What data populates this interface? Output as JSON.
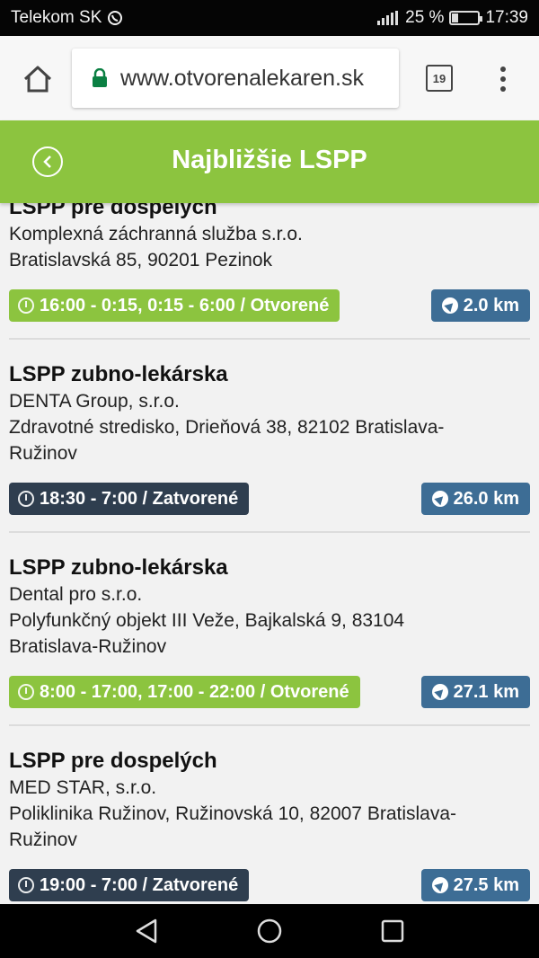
{
  "status_bar": {
    "carrier": "Telekom SK",
    "battery_percent": "25 %",
    "battery_level": 0.25,
    "time": "17:39",
    "signal_icon": "signal-icon",
    "whatsapp_icon": "whatsapp-icon"
  },
  "browser": {
    "url": "www.otvorenalekaren.sk",
    "tab_count": "19"
  },
  "header": {
    "title": "Najbližšie LSPP"
  },
  "colors": {
    "header_green": "#8cc43f",
    "open_badge": "#8cc43f",
    "closed_badge": "#2f3e4f",
    "distance_badge": "#3d6d95"
  },
  "entries": [
    {
      "title": "LSPP pre dospelých",
      "provider": "Komplexná záchranná služba s.r.o.",
      "address_lines": [
        "Bratislavská 85, 90201 Pezinok"
      ],
      "hours": "16:00 - 0:15, 0:15 - 6:00 / Otvorené",
      "status": "open",
      "distance": "2.0 km"
    },
    {
      "title": "LSPP zubno-lekárska",
      "provider": "DENTA Group, s.r.o.",
      "address_lines": [
        "Zdravotné stredisko, Drieňová 38, 82102 Bratislava-",
        "Ružinov"
      ],
      "hours": "18:30 - 7:00 / Zatvorené",
      "status": "closed",
      "distance": "26.0 km"
    },
    {
      "title": "LSPP zubno-lekárska",
      "provider": "Dental pro s.r.o.",
      "address_lines": [
        "Polyfunkčný objekt III Veže, Bajkalská 9, 83104",
        "Bratislava-Ružinov"
      ],
      "hours": "8:00 - 17:00, 17:00 - 22:00 / Otvorené",
      "status": "open",
      "distance": "27.1 km"
    },
    {
      "title": "LSPP pre dospelých",
      "provider": "MED STAR, s.r.o.",
      "address_lines": [
        "Poliklinika Ružinov, Ružinovská 10, 82007 Bratislava-",
        "Ružinov"
      ],
      "hours": "19:00 - 7:00 / Zatvorené",
      "status": "closed",
      "distance": "27.5 km"
    }
  ]
}
